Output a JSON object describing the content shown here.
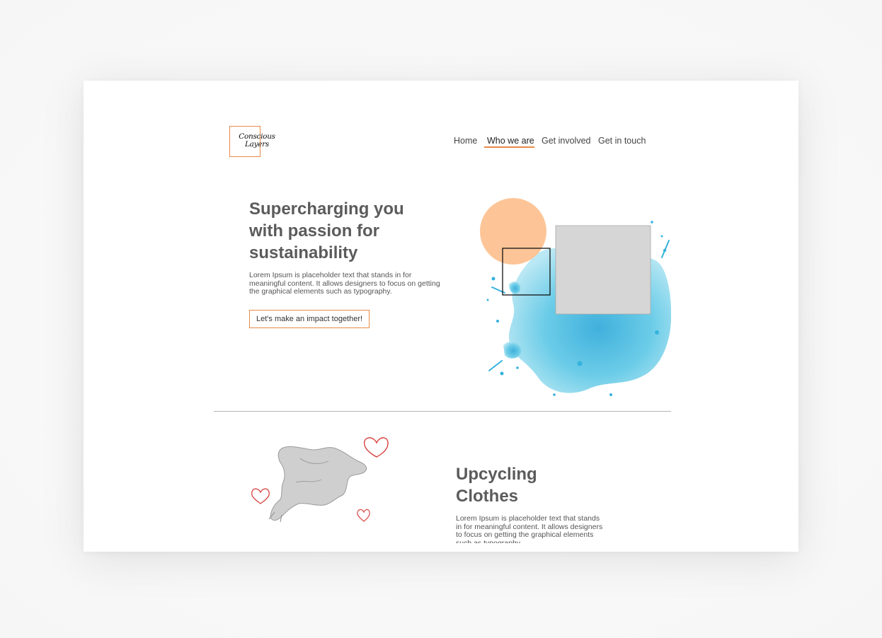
{
  "logo": {
    "line1": "Conscious",
    "line2": "Layers",
    "accent_color": "#e88a48"
  },
  "nav": {
    "items": [
      {
        "label": "Home"
      },
      {
        "label": "Who we are",
        "active": true
      },
      {
        "label": "Get involved"
      },
      {
        "label": "Get in touch"
      }
    ]
  },
  "hero": {
    "title": "Supercharging you with passion for sustainability",
    "body": "Lorem Ipsum is placeholder text that stands in for meaningful content. It allows designers to focus on getting the graphical elements such as typography.",
    "cta_label": "Let's make an impact together!"
  },
  "section2": {
    "title": "Upcycling Clothes",
    "body": "Lorem Ipsum is placeholder text that stands in for meaningful content. It allows designers to focus on getting the graphical elements such as typography."
  },
  "colors": {
    "accent": "#e88a48",
    "peach_circle": "#fdc597",
    "splash_blue": "#4fbfe0",
    "placeholder_gray": "#d6d6d6",
    "heading_gray": "#5b5b5b"
  }
}
